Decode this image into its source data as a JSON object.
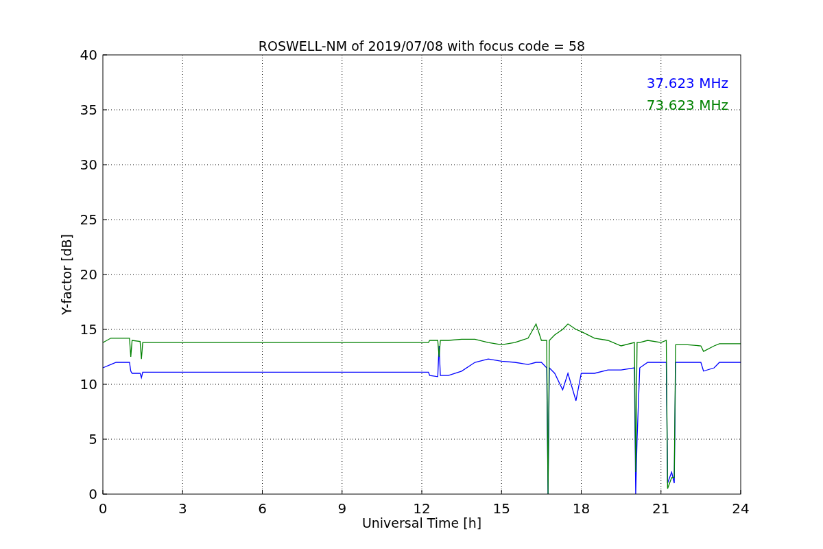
{
  "chart_data": {
    "type": "line",
    "title": "ROSWELL-NM of 2019/07/08 with focus code = 58",
    "xlabel": "Universal Time [h]",
    "ylabel": "Y-factor [dB]",
    "x": [
      0,
      0.3,
      0.5,
      1.0,
      1.05,
      1.1,
      1.4,
      1.45,
      1.5,
      12.25,
      12.3,
      12.6,
      12.65,
      12.7,
      13,
      13.5,
      14,
      14.5,
      15,
      15.5,
      16,
      16.3,
      16.5,
      16.7,
      16.75,
      16.8,
      17,
      17.3,
      17.5,
      17.8,
      18,
      18.5,
      19,
      19.5,
      20,
      20.05,
      20.1,
      20.2,
      20.5,
      21,
      21.2,
      21.25,
      21.4,
      21.5,
      21.55,
      22,
      22.5,
      22.6,
      23,
      23.2,
      24
    ],
    "series": [
      {
        "name": "37.623 MHz",
        "color": "#0000ff",
        "values": [
          11.5,
          11.8,
          12.0,
          12.0,
          11.2,
          11.0,
          11.0,
          10.6,
          11.1,
          11.1,
          10.8,
          10.7,
          13.5,
          10.8,
          10.8,
          11.2,
          12.0,
          12.3,
          12.1,
          12.0,
          11.8,
          12.0,
          12.0,
          11.5,
          0,
          11.5,
          11.0,
          9.5,
          11.0,
          8.5,
          11.0,
          11.0,
          11.3,
          11.3,
          11.5,
          0,
          5,
          11.5,
          12.0,
          12.0,
          12.0,
          1,
          2,
          1,
          12,
          12.0,
          12.0,
          11.2,
          11.5,
          12.0,
          12.0
        ]
      },
      {
        "name": "73.623 MHz",
        "color": "#008000",
        "values": [
          13.8,
          14.2,
          14.2,
          14.2,
          12.5,
          14.0,
          13.9,
          12.3,
          13.8,
          13.8,
          14.0,
          14.0,
          12.5,
          14.0,
          14.0,
          14.1,
          14.1,
          13.8,
          13.6,
          13.8,
          14.2,
          15.5,
          14.0,
          14.0,
          0,
          14.0,
          14.5,
          15.0,
          15.5,
          15.0,
          14.8,
          14.2,
          14.0,
          13.5,
          13.8,
          2,
          13.8,
          13.8,
          14.0,
          13.8,
          14.0,
          0.5,
          1.5,
          1.5,
          13.6,
          13.6,
          13.5,
          13.0,
          13.5,
          13.7,
          13.7
        ]
      }
    ],
    "xlim": [
      0,
      24
    ],
    "ylim": [
      0,
      40
    ],
    "xticks": [
      0,
      3,
      6,
      9,
      12,
      15,
      18,
      21,
      24
    ],
    "yticks": [
      0,
      5,
      10,
      15,
      20,
      25,
      30,
      35,
      40
    ],
    "grid": true
  }
}
